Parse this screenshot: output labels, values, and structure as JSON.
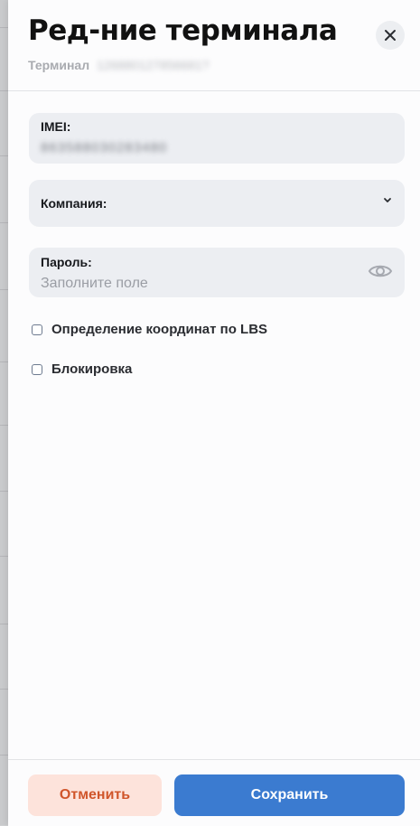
{
  "dialog": {
    "title": "Ред-ние терминала",
    "subtitle_label": "Терминал",
    "subtitle_value_blurred": "126880127856681?"
  },
  "form": {
    "imei": {
      "label": "IMEI:",
      "value_blurred": "863588030283480"
    },
    "company": {
      "label": "Компания:"
    },
    "password": {
      "label": "Пароль:",
      "placeholder": "Заполните поле"
    },
    "checkboxes": [
      {
        "label": "Определение координат по LBS",
        "checked": false
      },
      {
        "label": "Блокировка",
        "checked": false
      }
    ]
  },
  "footer": {
    "cancel_label": "Отменить",
    "save_label": "Сохранить"
  },
  "icons": {
    "close": "close-icon",
    "chevron": "chevron-down-icon",
    "eye": "eye-icon"
  },
  "colors": {
    "primary": "#3b7bd0",
    "cancel_bg": "#fde3db",
    "cancel_text": "#d0552a"
  }
}
